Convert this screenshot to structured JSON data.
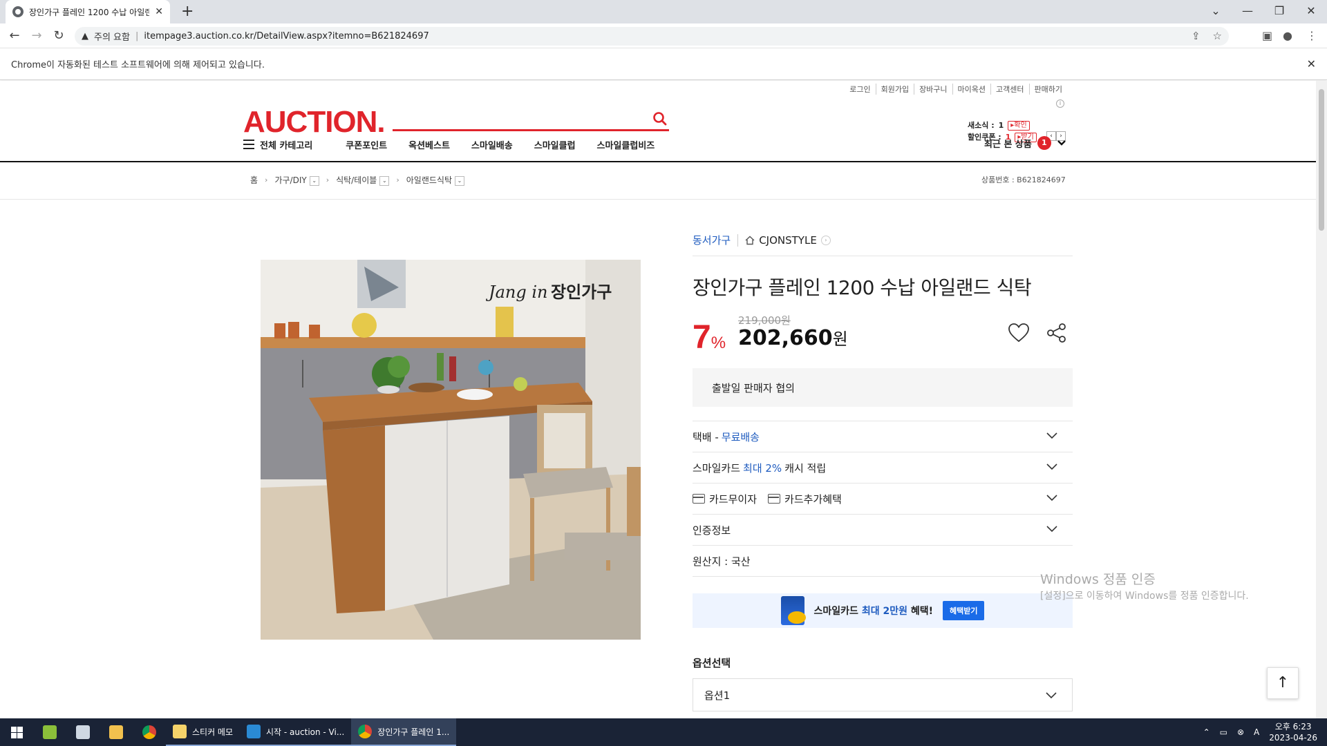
{
  "browser": {
    "tab_title": "장인가구 플레인 1200 수납 아일랜드 식탁",
    "warning": "주의 요함",
    "url": "itempage3.auction.co.kr/DetailView.aspx?itemno=B621824697",
    "infobar": "Chrome이 자동화된 테스트 소프트웨어에 의해 제어되고 있습니다."
  },
  "header": {
    "util_links": [
      "로그인",
      "회원가입",
      "장바구니",
      "마이옥션",
      "고객센터",
      "판매하기"
    ],
    "logo": "AUCTION.",
    "search_placeholder": "",
    "new_label": "새소식 :",
    "new_count": "1",
    "new_btn": "확인",
    "coupon_label": "할인쿠폰 :",
    "coupon_count": "1",
    "coupon_btn": "받기"
  },
  "gnb": {
    "all_category": "전체 카테고리",
    "items": [
      "쿠폰포인트",
      "옥션베스트",
      "스마일배송",
      "스마일클럽",
      "스마일클럽비즈"
    ],
    "recent_label": "최근 본 상품",
    "recent_count": "1"
  },
  "breadcrumb": {
    "home": "홈",
    "items": [
      "가구/DIY",
      "식탁/테이블",
      "아일랜드식탁"
    ],
    "product_no": "상품번호 : B621824697"
  },
  "product": {
    "seller": "동서가구",
    "store": "CJONSTYLE",
    "title": "장인가구 플레인 1200 수납 아일랜드 식탁",
    "discount": "7",
    "discount_unit": "%",
    "original_price": "219,000원",
    "price": "202,660",
    "price_unit": "원",
    "image_brand": "장인가구",
    "image_script": "Jang in",
    "shipping": "출발일 판매자 협의",
    "delivery_prefix": "택배 - ",
    "delivery_free": "무료배송",
    "smilecard_prefix": "스마일카드 ",
    "smilecard_highlight": "최대 2%",
    "smilecard_suffix": " 캐시 적립",
    "card_nointerest": "카드무이자",
    "card_benefit": "카드추가혜택",
    "cert": "인증정보",
    "origin": "원산지 : 국산",
    "banner_prefix": "스마일카드 ",
    "banner_highlight": "최대 2만원",
    "banner_suffix": " 혜택!",
    "banner_btn": "혜택받기",
    "option_label": "옵션선택",
    "option_value": "옵션1"
  },
  "overlay": {
    "activate_title": "Windows 정품 인증",
    "activate_sub": "[설정]으로 이동하여 Windows를 정품 인증합니다."
  },
  "taskbar": {
    "sticky": "스티커 메모",
    "vscode": "시작 - auction - Vi...",
    "chrome": "장인가구 플레인 1...",
    "time": "오후 6:23",
    "date": "2023-04-26"
  },
  "colors": {
    "brand_red": "#e0242b",
    "link_blue": "#1e5bbf",
    "taskbar": "#1a2336"
  }
}
